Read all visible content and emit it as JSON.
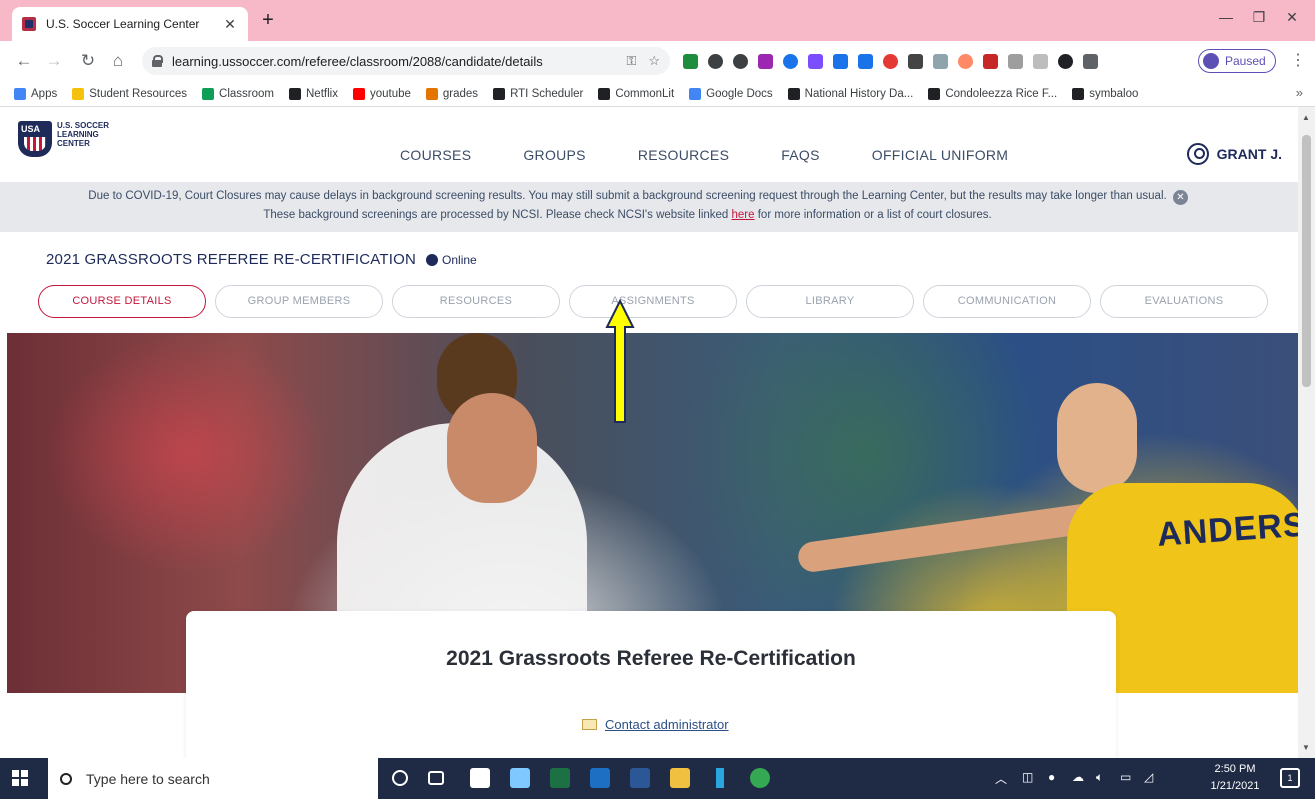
{
  "browser": {
    "tab_title": "U.S. Soccer Learning Center",
    "url": "learning.ussoccer.com/referee/classroom/2088/candidate/details",
    "profile_label": "Paused"
  },
  "bookmarks": [
    {
      "label": "Apps",
      "color": "#4285f4"
    },
    {
      "label": "Student Resources",
      "color": "#f4c20d"
    },
    {
      "label": "Classroom",
      "color": "#0f9d58"
    },
    {
      "label": "Netflix",
      "color": "#202124"
    },
    {
      "label": "youtube",
      "color": "#ff0000"
    },
    {
      "label": "grades",
      "color": "#e37400"
    },
    {
      "label": "RTI Scheduler",
      "color": "#202124"
    },
    {
      "label": "CommonLit",
      "color": "#202124"
    },
    {
      "label": "Google Docs",
      "color": "#4285f4"
    },
    {
      "label": "National History Da...",
      "color": "#202124"
    },
    {
      "label": "Condoleezza Rice F...",
      "color": "#202124"
    },
    {
      "label": "symbaloo",
      "color": "#202124"
    }
  ],
  "site": {
    "logo_text": "U.S. SOCCER LEARNING CENTER",
    "nav": [
      "COURSES",
      "GROUPS",
      "RESOURCES",
      "FAQS",
      "OFFICIAL UNIFORM"
    ],
    "user_name": "GRANT J."
  },
  "notice": {
    "line1": "Due to COVID-19, Court Closures may cause delays in background screening results. You may still submit a background screening request through the Learning Center, but the results may take longer than usual.",
    "line2_before": "These background screenings are processed by NCSI. Please check NCSI's website linked ",
    "link_text": "here",
    "line2_after": " for more information or a list of court closures."
  },
  "course": {
    "title": "2021 GRASSROOTS REFEREE RE-CERTIFICATION",
    "mode": "Online",
    "tabs": [
      "COURSE DETAILS",
      "GROUP MEMBERS",
      "RESOURCES",
      "ASSIGNMENTS",
      "LIBRARY",
      "COMMUNICATION",
      "EVALUATIONS"
    ],
    "active_tab": 0,
    "card_title": "2021 Grassroots Referee Re-Certification",
    "contact_label": "Contact administrator"
  },
  "hero": {
    "jersey_name": "ANDERSSON"
  },
  "taskbar": {
    "search_placeholder": "Type here to search",
    "time": "2:50 PM",
    "date": "1/21/2021",
    "notifications": "1"
  },
  "colors": {
    "accent_red": "#c4163c",
    "navy": "#1d2a5a",
    "tab_strip": "#f7b8c8"
  }
}
